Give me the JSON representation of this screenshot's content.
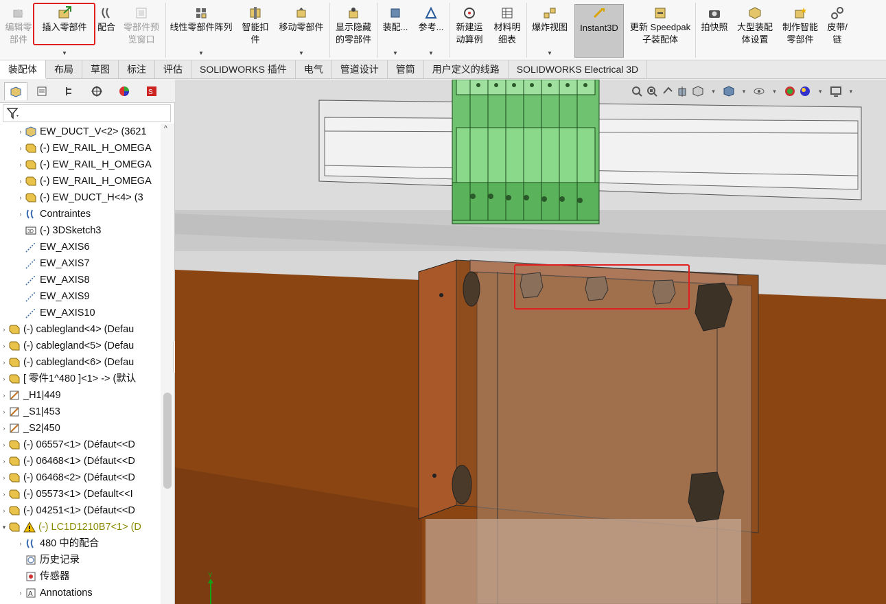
{
  "ribbon": {
    "buttons": [
      {
        "label": "编辑零\n部件",
        "icon": "edit-component-icon",
        "disabled": true
      },
      {
        "label": "插入零部件",
        "icon": "insert-component-icon",
        "disabled": false,
        "highlighted": true
      },
      {
        "label": "配合",
        "icon": "mate-icon",
        "disabled": false
      },
      {
        "label": "零部件预\n览窗口",
        "icon": "component-preview-icon",
        "disabled": true
      },
      {
        "label": "线性零部件阵列",
        "icon": "linear-pattern-icon",
        "disabled": false
      },
      {
        "label": "智能扣\n件",
        "icon": "smart-fastener-icon",
        "disabled": false
      },
      {
        "label": "移动零部件",
        "icon": "move-component-icon",
        "disabled": false
      },
      {
        "label": "显示隐藏\n的零部件",
        "icon": "show-hidden-icon",
        "disabled": false
      },
      {
        "label": "装配...",
        "icon": "assembly-features-icon",
        "disabled": false
      },
      {
        "label": "参考...",
        "icon": "reference-geometry-icon",
        "disabled": false
      },
      {
        "label": "新建运\n动算例",
        "icon": "motion-study-icon",
        "disabled": false
      },
      {
        "label": "材料明\n细表",
        "icon": "bom-icon",
        "disabled": false
      },
      {
        "label": "爆炸视图",
        "icon": "exploded-view-icon",
        "disabled": false
      },
      {
        "label": "Instant3D",
        "icon": "instant3d-icon",
        "disabled": false,
        "active": true
      },
      {
        "label": "更新 Speedpak\n子装配体",
        "icon": "speedpak-icon",
        "disabled": false
      },
      {
        "label": "拍快照",
        "icon": "snapshot-icon",
        "disabled": false
      },
      {
        "label": "大型装配\n体设置",
        "icon": "large-assembly-icon",
        "disabled": false
      },
      {
        "label": "制作智能\n零部件",
        "icon": "smart-component-icon",
        "disabled": false
      },
      {
        "label": "皮带/\n链",
        "icon": "belt-chain-icon",
        "disabled": false
      }
    ]
  },
  "tabs": [
    "装配体",
    "布局",
    "草图",
    "标注",
    "评估",
    "SOLIDWORKS 插件",
    "电气",
    "管道设计",
    "管筒",
    "用户定义的线路",
    "SOLIDWORKS Electrical 3D"
  ],
  "tree": [
    {
      "label": "EW_DUCT_V<2> (3621",
      "icon": "assembly-icon",
      "expand": true
    },
    {
      "label": "(-) EW_RAIL_H_OMEGA",
      "icon": "part-icon",
      "expand": true
    },
    {
      "label": "(-) EW_RAIL_H_OMEGA",
      "icon": "part-icon",
      "expand": true
    },
    {
      "label": "(-) EW_RAIL_H_OMEGA",
      "icon": "part-icon",
      "expand": true
    },
    {
      "label": "(-) EW_DUCT_H<4> (3",
      "icon": "part-icon",
      "expand": true
    },
    {
      "label": "Contraintes",
      "icon": "mates-folder-icon",
      "expand": true
    },
    {
      "label": "(-) 3DSketch3",
      "icon": "3dsketch-icon",
      "expand": false
    },
    {
      "label": "EW_AXIS6",
      "icon": "axis-icon",
      "expand": false
    },
    {
      "label": "EW_AXIS7",
      "icon": "axis-icon",
      "expand": false
    },
    {
      "label": "EW_AXIS8",
      "icon": "axis-icon",
      "expand": false
    },
    {
      "label": "EW_AXIS9",
      "icon": "axis-icon",
      "expand": false
    },
    {
      "label": "EW_AXIS10",
      "icon": "axis-icon",
      "expand": false
    },
    {
      "label": "(-) cablegland<4> (Defau",
      "icon": "part-icon",
      "expand": true
    },
    {
      "label": "(-) cablegland<5> (Defau",
      "icon": "part-icon",
      "expand": true
    },
    {
      "label": "(-) cablegland<6> (Defau",
      "icon": "part-icon",
      "expand": true
    },
    {
      "label": "[ 零件1^480 ]<1> -> (默认",
      "icon": "part-icon",
      "expand": true
    },
    {
      "label": "_H1|449",
      "icon": "sketch-part-icon",
      "expand": true
    },
    {
      "label": "_S1|453",
      "icon": "sketch-part-icon",
      "expand": true
    },
    {
      "label": "_S2|450",
      "icon": "sketch-part-icon",
      "expand": true
    },
    {
      "label": "(-) 06557<1> (Défaut<<D",
      "icon": "part-icon",
      "expand": true
    },
    {
      "label": "(-) 06468<1> (Défaut<<D",
      "icon": "part-icon",
      "expand": true
    },
    {
      "label": "(-) 06468<2> (Défaut<<D",
      "icon": "part-icon",
      "expand": true
    },
    {
      "label": "(-) 05573<1> (Default<<I",
      "icon": "part-icon",
      "expand": true
    },
    {
      "label": "(-) 04251<1> (Défaut<<D",
      "icon": "part-icon",
      "expand": true
    },
    {
      "label": "(-) LC1D1210B7<1> (D",
      "icon": "part-warning-icon",
      "expand": "open",
      "warning": true
    },
    {
      "label": "480 中的配合",
      "icon": "mates-folder-icon",
      "expand": true
    },
    {
      "label": "历史记录",
      "icon": "history-icon",
      "expand": false
    },
    {
      "label": "传感器",
      "icon": "sensor-icon",
      "expand": false
    },
    {
      "label": "Annotations",
      "icon": "annotations-icon",
      "expand": true
    }
  ],
  "viewport": {
    "triad_label": "Y"
  },
  "colors": {
    "highlight": "#e02020",
    "brown_panel": "#8b4513",
    "terminal_green": "#7ad07a",
    "rail_gray": "#e6e6e6"
  }
}
